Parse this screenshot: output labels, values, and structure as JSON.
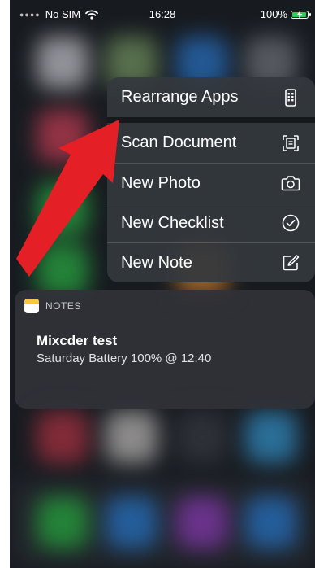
{
  "status_bar": {
    "carrier": "No SIM",
    "time": "16:28",
    "battery_percent": "100%",
    "battery_level": 1.0
  },
  "menu": {
    "items": [
      {
        "label": "Rearrange Apps",
        "icon": "phone-grid-icon"
      },
      {
        "label": "Scan Document",
        "icon": "scan-document-icon"
      },
      {
        "label": "New Photo",
        "icon": "camera-icon"
      },
      {
        "label": "New Checklist",
        "icon": "checkmark-circle-icon"
      },
      {
        "label": "New Note",
        "icon": "compose-icon"
      }
    ]
  },
  "widget": {
    "app_name": "NOTES",
    "note_title": "Mixcder test",
    "note_subtitle": "Saturday  Battery 100% @ 12:40"
  },
  "colors": {
    "arrow": "#e41f26",
    "notes_yellow": "#f7c644",
    "battery_green": "#34c759",
    "menu_bg": "#34383e",
    "widget_bg": "#303238"
  }
}
